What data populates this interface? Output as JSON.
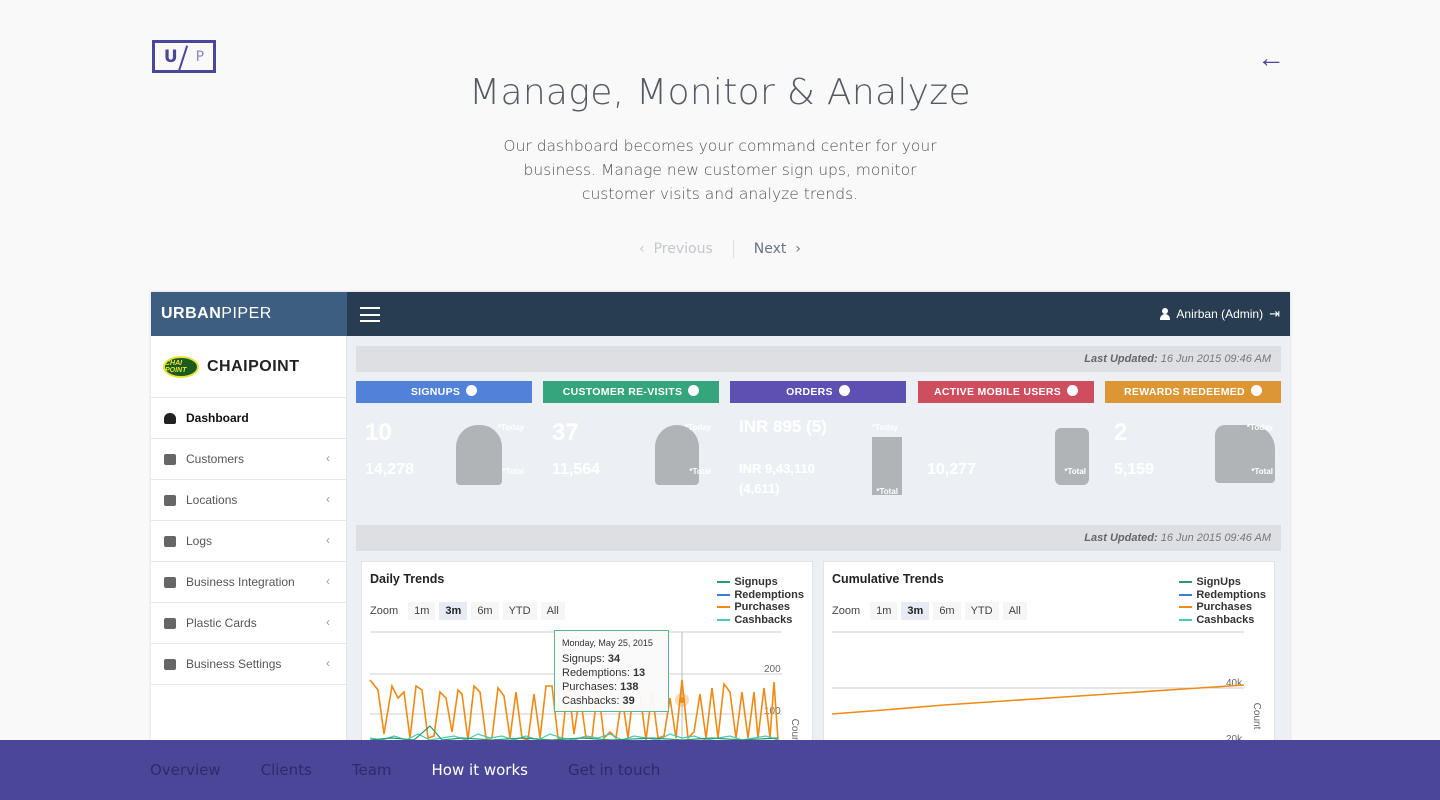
{
  "brand": {
    "logo_left": "U",
    "logo_right": "P"
  },
  "hero": {
    "title": "Manage, Monitor & Analyze",
    "description": "Our dashboard becomes your command center for your business. Manage new customer sign ups, monitor customer visits and analyze trends.",
    "previous_label": "Previous",
    "next_label": "Next",
    "back_arrow": "←"
  },
  "dashboard": {
    "brand_bold": "URBAN",
    "brand_light": "PIPER",
    "user_label": "Anirban (Admin)",
    "client_logo_text": "CHAI POINT",
    "client_name": "CHAIPOINT",
    "nav": [
      {
        "label": "Dashboard",
        "icon": "dashboard-icon"
      },
      {
        "label": "Customers",
        "icon": "users-icon"
      },
      {
        "label": "Locations",
        "icon": "grid-icon"
      },
      {
        "label": "Logs",
        "icon": "edit-icon"
      },
      {
        "label": "Business Integration",
        "icon": "plus-square-icon"
      },
      {
        "label": "Plastic Cards",
        "icon": "credit-card-icon"
      },
      {
        "label": "Business Settings",
        "icon": "briefcase-icon"
      }
    ],
    "last_updated_label": "Last Updated:",
    "last_updated_value": "16 Jun 2015 09:46 AM",
    "cards": [
      {
        "title": "SIGNUPS",
        "today": "10",
        "total": "14,278",
        "color": "#5b8fe8"
      },
      {
        "title": "CUSTOMER RE-VISITS",
        "today": "37",
        "total": "11,564",
        "color": "#3fb98f"
      },
      {
        "title": "ORDERS",
        "today": "INR 895 (5)",
        "total": "INR 9,43,110 (4,611)",
        "color": "#6d5ec2"
      },
      {
        "title": "ACTIVE MOBILE USERS",
        "today": "",
        "total": "10,277",
        "color": "#e0606f"
      },
      {
        "title": "REWARDS REDEEMED",
        "today": "2",
        "total": "5,159",
        "color": "#f2aa3f"
      }
    ],
    "tag_today": "*Today",
    "tag_total": "*Total",
    "charts": {
      "daily": {
        "title": "Daily Trends",
        "zoom_label": "Zoom",
        "zoom_options": [
          "1m",
          "3m",
          "6m",
          "YTD",
          "All"
        ],
        "zoom_selected": "3m",
        "legend": [
          "Signups",
          "Redemptions",
          "Purchases",
          "Cashbacks"
        ],
        "axis_title": "Count",
        "ticks": [
          "200",
          "100"
        ],
        "tooltip": {
          "date": "Monday, May 25, 2015",
          "signups_label": "Signups:",
          "signups": "34",
          "redemptions_label": "Redemptions:",
          "redemptions": "13",
          "purchases_label": "Purchases:",
          "purchases": "138",
          "cashbacks_label": "Cashbacks:",
          "cashbacks": "39"
        }
      },
      "cumulative": {
        "title": "Cumulative Trends",
        "zoom_label": "Zoom",
        "zoom_options": [
          "1m",
          "3m",
          "6m",
          "YTD",
          "All"
        ],
        "zoom_selected": "3m",
        "legend": [
          "SignUps",
          "Redemptions",
          "Purchases",
          "Cashbacks"
        ],
        "axis_title": "Count",
        "ticks": [
          "40k",
          "20k"
        ]
      },
      "series_colors": {
        "signups": "#2c9a6e",
        "redemptions": "#3a7fd1",
        "purchases": "#f08a12",
        "cashbacks": "#45c9b8"
      }
    }
  },
  "bottom_nav": {
    "items": [
      "Overview",
      "Clients",
      "Team",
      "How it works",
      "Get in touch"
    ],
    "active": "How it works"
  }
}
